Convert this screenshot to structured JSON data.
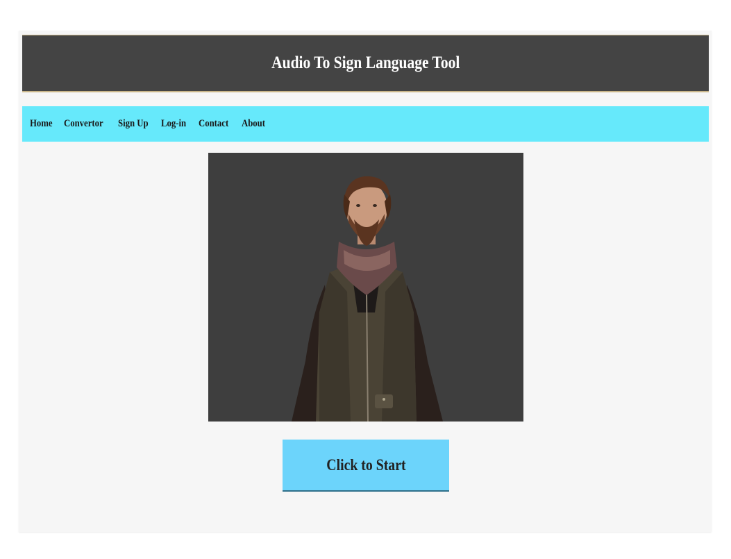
{
  "header": {
    "title": "Audio To Sign Language Tool"
  },
  "nav": {
    "items": [
      {
        "label": "Home"
      },
      {
        "label": "Convertor"
      },
      {
        "label": "Sign Up"
      },
      {
        "label": "Log-in"
      },
      {
        "label": "Contact"
      },
      {
        "label": "About"
      }
    ]
  },
  "main": {
    "avatar_icon": "person-avatar-3d",
    "start_button_label": "Click to Start"
  },
  "colors": {
    "header_bg": "#444444",
    "nav_bg": "#66e9fb",
    "button_bg": "#6cd4fb",
    "panel_bg": "#3e3e3e",
    "page_bg": "#f6f6f6"
  }
}
